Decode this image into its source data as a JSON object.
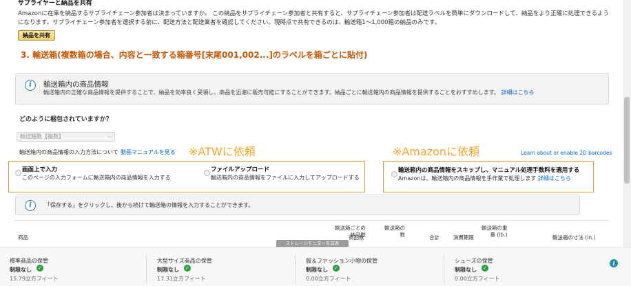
{
  "top": {
    "heading": "サプライヤーと納品を共有",
    "description": "Amazonに在庫を納品するサプライチェーン参加者は決まっていますか。 この納品をサプライチェーン参加者と共有すると、サプライチェーン参加者は配送ラベルを簡単にダウンロードして、納品をより正確に処理できるようになります。サプライチェーン参加者を選択する前に、配送方法と配送業者を確認してください。現時点で共有できるのは、輸送箱1～1,000箱の納品のみです。",
    "share_button": "納品を共有"
  },
  "step": {
    "heading": "3. 輸送箱(複数箱の場合、内容と一致する箱番号[末尾001,002...]のラベルを箱ごとに貼付)"
  },
  "info_box": {
    "icon": "info-icon",
    "title": "輸送箱内の商品情報",
    "text": "輸送箱内の正確な商品情報を提供することで、納品を効率良く受領し、商品を迅速に販売可能にすることができます。納品ごとに輸送箱内の商品情報を提供することをおすすめします。",
    "link": "詳細はこちら"
  },
  "packing": {
    "question": "どのように梱包されていますか？",
    "select_value": "輸送箱数【複数】",
    "method_label": "輸送箱内の商品情報の入力方法について",
    "manual_link": "動画マニュアルを見る",
    "barcode_link": "Learn about or enable 2D barcodes"
  },
  "annotations": {
    "atw": "※ATWに依頼",
    "amazon": "※Amazonに依頼"
  },
  "options": {
    "web": {
      "title": "画面上で入力",
      "desc": "このページの入力フォームに輸送箱内の商品情報を入力する"
    },
    "file": {
      "title": "ファイルアップロード",
      "desc": "輸送箱内の商品情報をファイルに入力してアップロードする"
    },
    "skip": {
      "title": "輸送箱内の商品情報をスキップし、マニュアル処理手数料を適用する",
      "desc": "Amazonは、輸送箱内の商品情報を手作業で処理します",
      "link": "詳細はこちら"
    }
  },
  "save_info": {
    "text": "「保存する」をクリックし、後から続けて輸送箱の情報を入力することができます。"
  },
  "table": {
    "product": "商品",
    "units_per_box": "輸送箱ごとの\n納品数",
    "boxes": "輸送箱の\n数",
    "units_total": "商品数",
    "total": "合計",
    "expiry": "消費期限",
    "weight": "輸送箱の重\n量 (lb.)",
    "dims": "輸送箱の寸法 (in.)"
  },
  "storage_tab": "ストレージモニターを非表",
  "footer": {
    "columns": [
      {
        "title": "標準商品の保管",
        "limit": "制限なし",
        "volume": "15.79立方フィート"
      },
      {
        "title": "大型サイズ商品の保管",
        "limit": "制限なし",
        "volume": "17.31立方フィート"
      },
      {
        "title": "服＆ファッション小物の保管",
        "limit": "制限なし",
        "volume": "0.00立方フィート"
      },
      {
        "title": "シューズの保管",
        "limit": "制限なし",
        "volume": "0.00立方フィート"
      }
    ]
  },
  "colors": {
    "accent_orange": "#c45500",
    "annotation_orange": "#f3a427",
    "link_blue": "#0066c0",
    "check_green": "#2a9d3f"
  }
}
